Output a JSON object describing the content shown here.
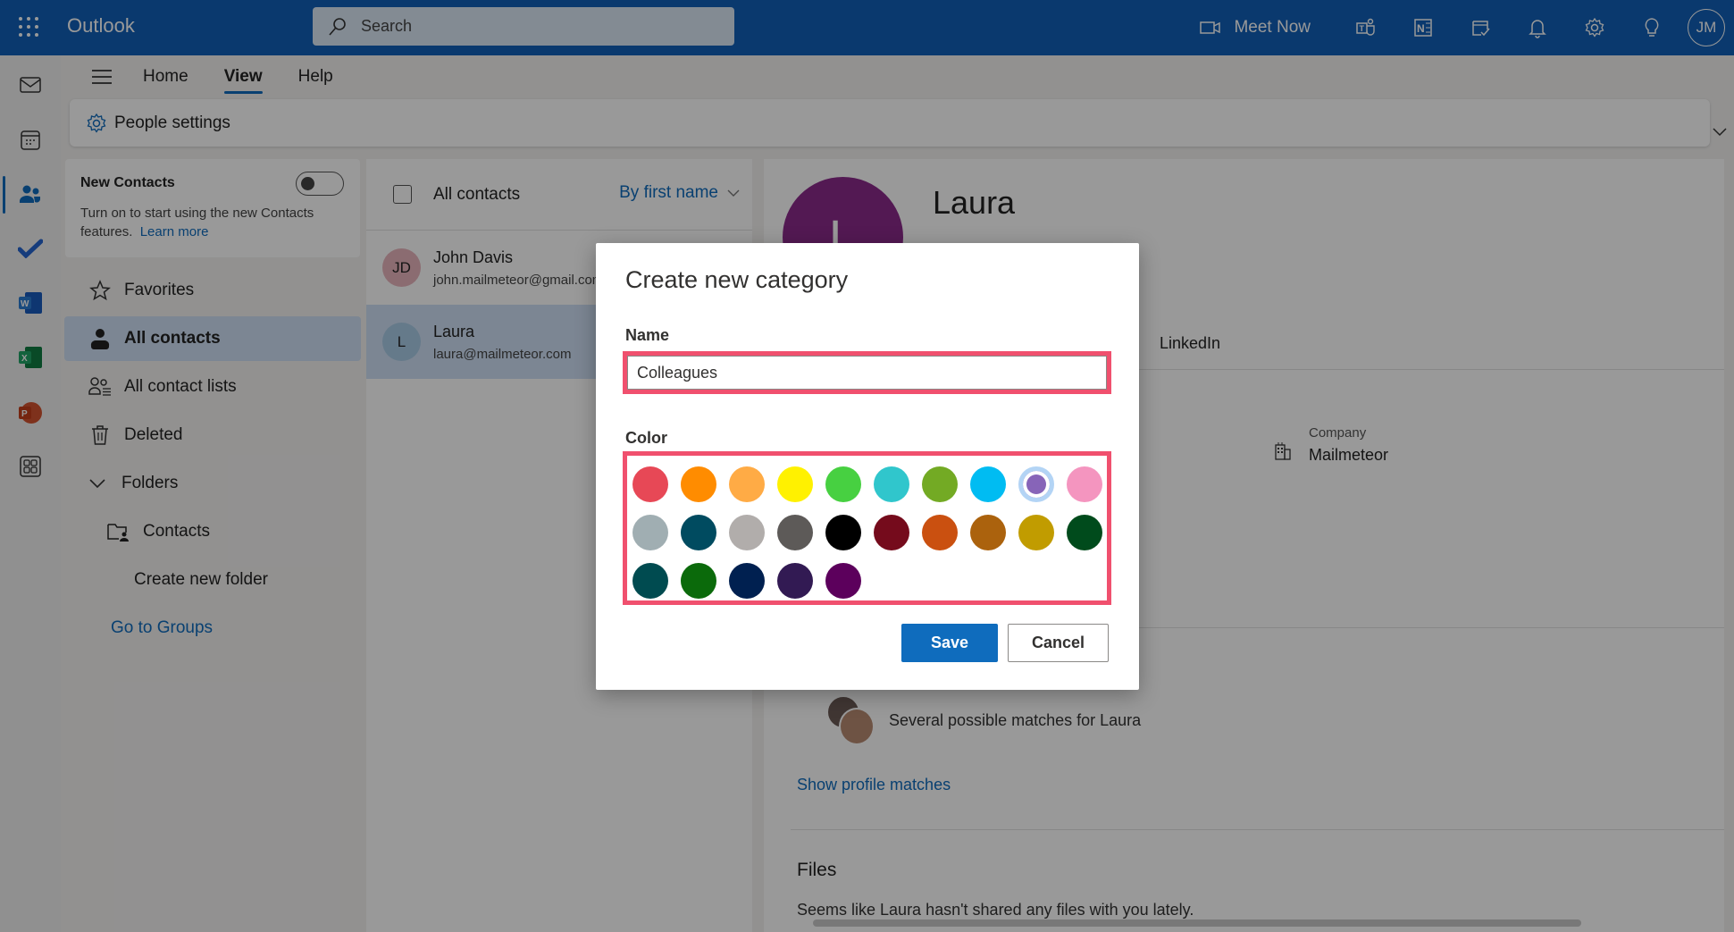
{
  "topbar": {
    "app_name": "Outlook",
    "search_placeholder": "Search",
    "meet_now": "Meet Now",
    "avatar_initials": "JM",
    "icons": [
      "waffle-icon",
      "search-icon",
      "video-icon",
      "teams-icon",
      "onenote-icon",
      "my-day-icon",
      "bell-icon",
      "gear-icon",
      "lightbulb-icon"
    ]
  },
  "rail": {
    "items": [
      "mail",
      "calendar",
      "people",
      "todo",
      "word",
      "excel",
      "powerpoint",
      "more-apps"
    ],
    "active": "people"
  },
  "ribbon": {
    "tabs": [
      {
        "label": "Home",
        "active": false
      },
      {
        "label": "View",
        "active": true
      },
      {
        "label": "Help",
        "active": false
      }
    ],
    "people_settings": "People settings"
  },
  "new_contacts": {
    "title": "New Contacts",
    "description": "Turn on to start using the new Contacts features.",
    "learn_more": "Learn more",
    "toggle_on": false
  },
  "nav": {
    "favorites": "Favorites",
    "all_contacts": "All contacts",
    "all_contact_lists": "All contact lists",
    "deleted": "Deleted",
    "folders": "Folders",
    "contacts_folder": "Contacts",
    "create_new_folder": "Create new folder",
    "go_to_groups": "Go to Groups"
  },
  "contact_list": {
    "title": "All contacts",
    "sort": "By first name",
    "contacts": [
      {
        "initials": "JD",
        "name": "John Davis",
        "email": "john.mailmeteor@gmail.com",
        "avatar_color": "#e8b4bc",
        "selected": false
      },
      {
        "initials": "L",
        "name": "Laura",
        "email": "laura@mailmeteor.com",
        "avatar_color": "#a9cbe6",
        "selected": true
      }
    ]
  },
  "detail": {
    "initial": "L",
    "name": "Laura",
    "avatar_color": "#8a2a8a",
    "linkedin_tab": "LinkedIn",
    "company_label": "Company",
    "company_value": "Mailmeteor",
    "matches_text": "Several possible matches for Laura",
    "show_matches": "Show profile matches",
    "files_title": "Files",
    "files_desc": "Seems like Laura hasn't shared any files with you lately."
  },
  "dialog": {
    "title": "Create new category",
    "name_label": "Name",
    "name_value": "Colleagues",
    "color_label": "Color",
    "selected_color_index": 8,
    "colors": [
      "#e74856",
      "#ff8c00",
      "#ffab45",
      "#fff100",
      "#47d041",
      "#30c6cc",
      "#73aa24",
      "#00bcf2",
      "#8764b8",
      "#f495bf",
      "#a0aeb2",
      "#004b60",
      "#b1adab",
      "#5d5a58",
      "#000000",
      "#750b1c",
      "#ca5010",
      "#ab620d",
      "#c19c00",
      "#004b1c",
      "#004b50",
      "#0b6a0b",
      "#002050",
      "#321a53",
      "#5c005c"
    ],
    "save": "Save",
    "cancel": "Cancel"
  },
  "colors": {
    "brand_blue": "#0f6cbd",
    "highlight_red": "#f0506e"
  }
}
